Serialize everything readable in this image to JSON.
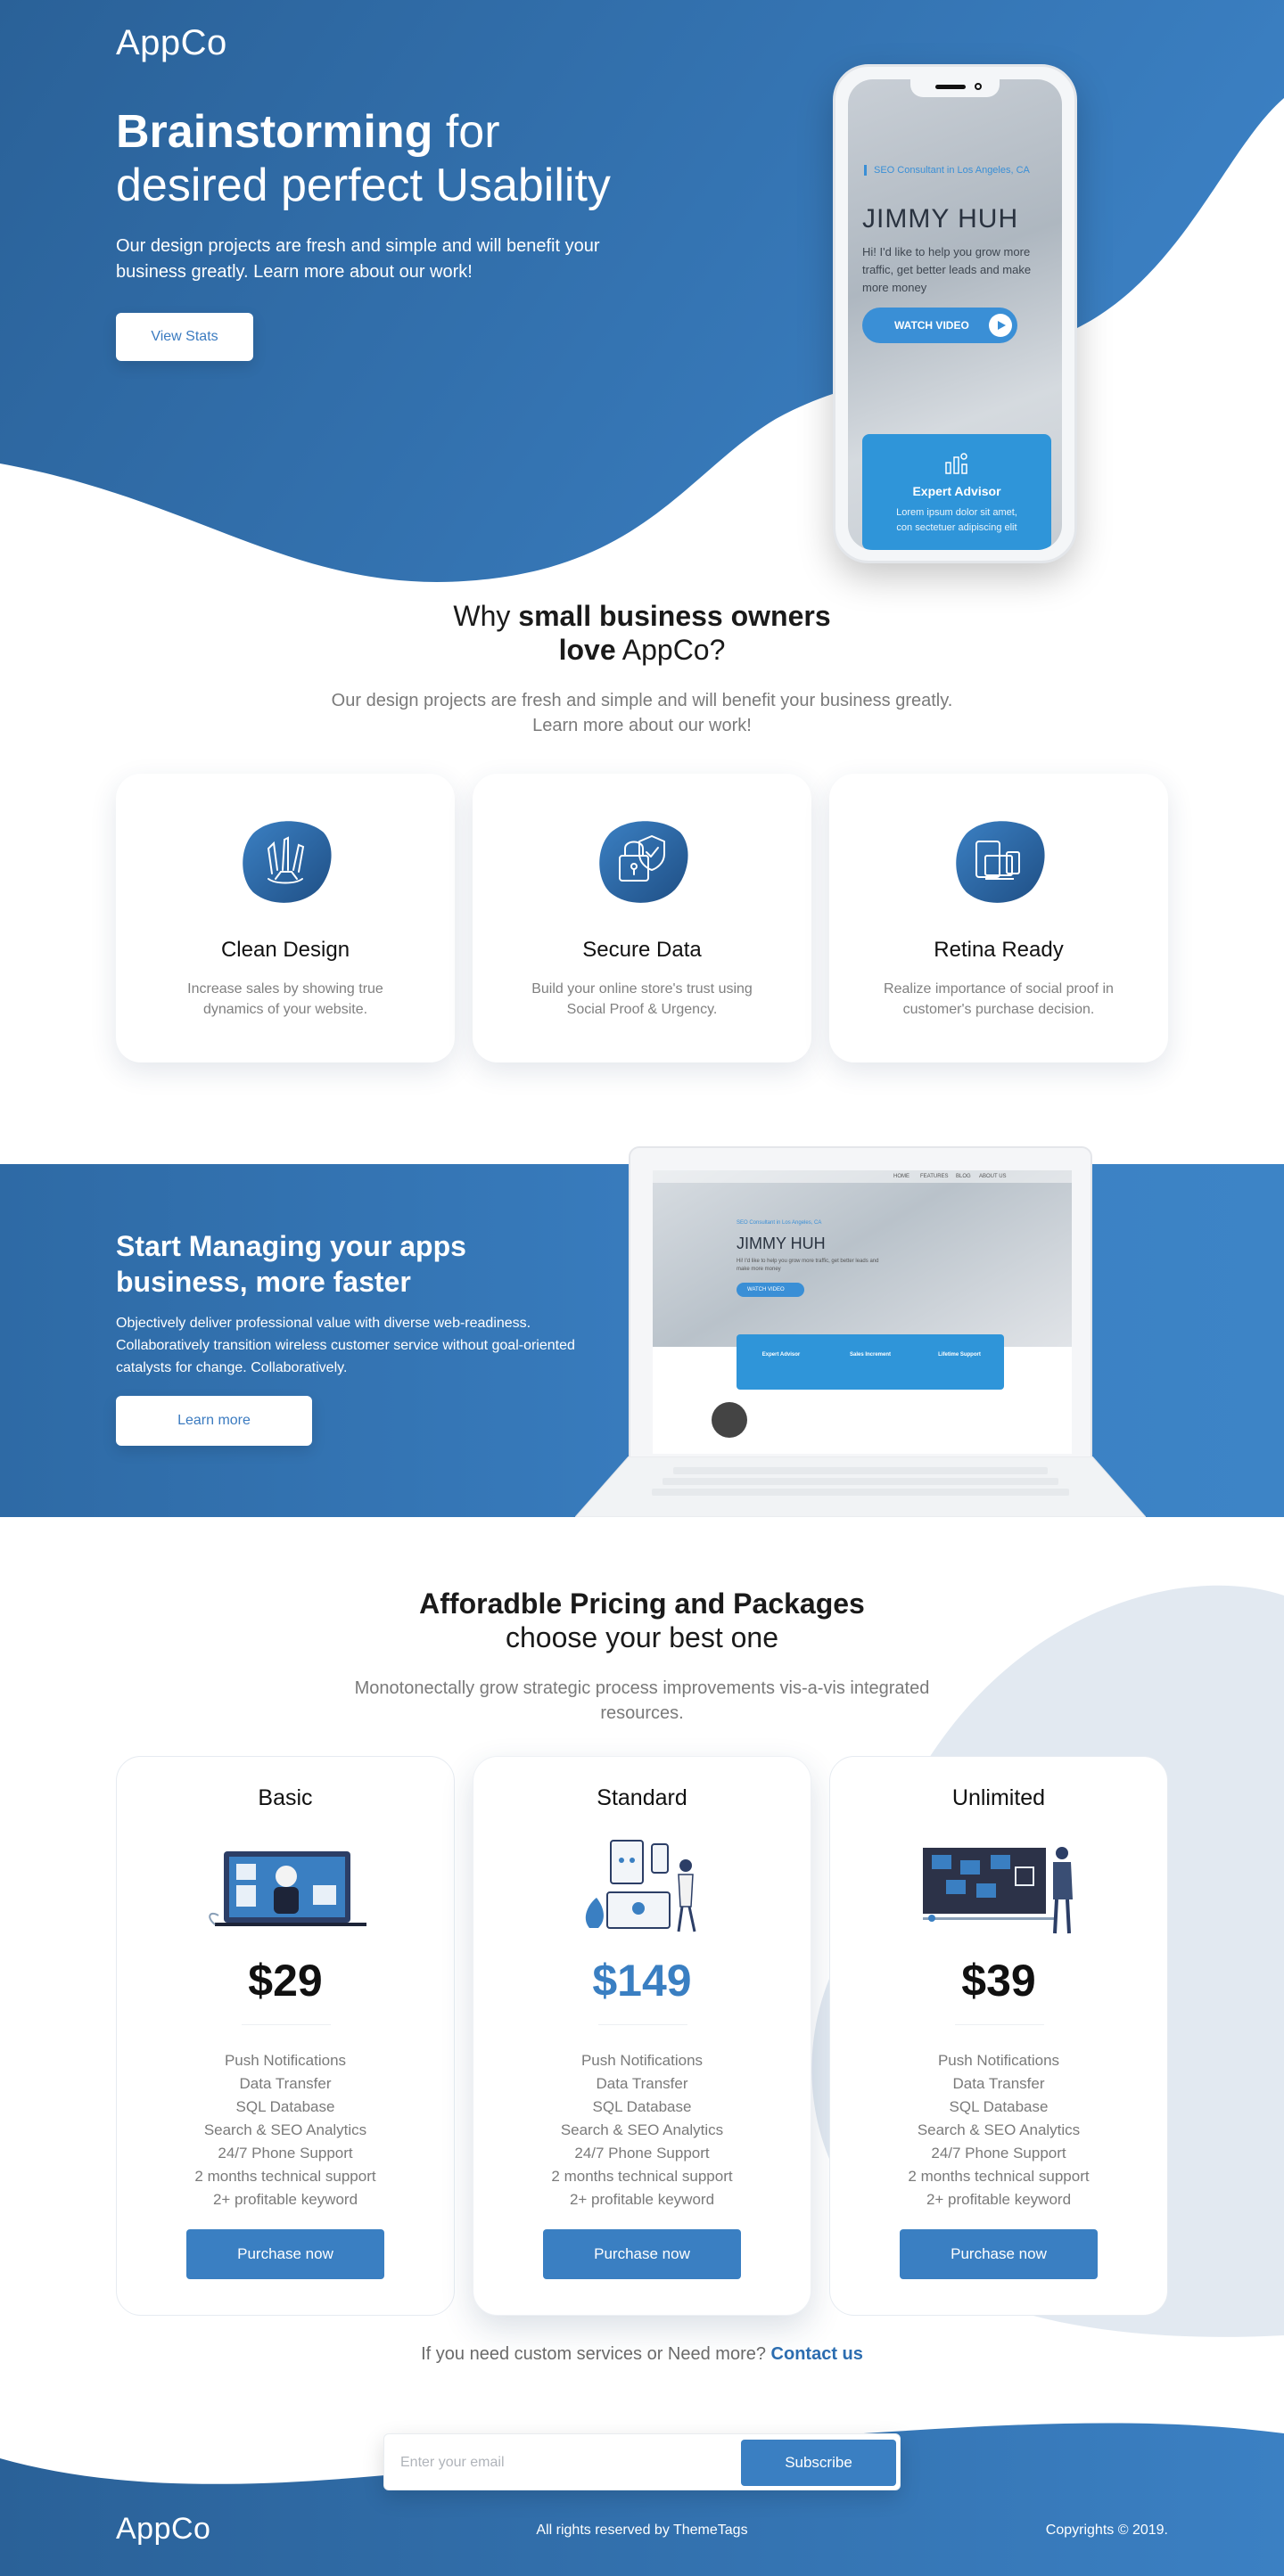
{
  "hero": {
    "logo": "AppCo",
    "title_bold": "Brainstorming",
    "title_rest": " for",
    "title_line2": "desired perfect Usability",
    "description": "Our design projects are fresh and simple and will benefit your business greatly. Learn more about our work!",
    "button": "View Stats",
    "phone": {
      "tag": "SEO Consultant in Los Angeles, CA",
      "name": "JIMMY HUH",
      "text": "Hi! I'd like to help you grow more traffic, get better leads and make more money",
      "button": "WATCH VIDEO",
      "card_title": "Expert Advisor",
      "card_text": "Lorem ipsum dolor sit amet, con sectetuer adipiscing elit"
    }
  },
  "why": {
    "title_part1": "Why ",
    "title_bold": "small business owners",
    "title_bold2": "love",
    "title_part2": " AppCo?",
    "description": "Our design projects are fresh and simple and will benefit your business greatly. Learn more about our work!",
    "features": [
      {
        "title": "Clean Design",
        "text": "Increase sales by showing true dynamics of your website.",
        "icon": "pencils-icon"
      },
      {
        "title": "Secure Data",
        "text": "Build your online store's trust using Social Proof & Urgency.",
        "icon": "lock-shield-icon"
      },
      {
        "title": "Retina Ready",
        "text": "Realize importance of social proof in customer's purchase decision.",
        "icon": "devices-icon"
      }
    ]
  },
  "manage": {
    "title": "Start Managing your apps business, more faster",
    "description": "Objectively deliver professional value with diverse web-readiness. Collaboratively transition wireless customer service without goal-oriented catalysts for change. Collaboratively.",
    "button": "Learn more",
    "laptop": {
      "nav": [
        "HOME",
        "FEATURES",
        "BLOG",
        "ABOUT US"
      ],
      "tag": "SEO Consultant in Los Angeles, CA",
      "name": "JIMMY HUH",
      "text": "Hi! I'd like to help you grow more traffic, get better leads and make more money",
      "button": "WATCH VIDEO",
      "cards": [
        "Expert Advisor",
        "Sales Increment",
        "Lifetime Support"
      ]
    }
  },
  "pricing": {
    "title_bold": "Afforadble Pricing and Packages",
    "title_line2": "choose your best one",
    "description": "Monotonectally grow strategic process improvements vis-a-vis integrated resources.",
    "plans": [
      {
        "name": "Basic",
        "price": "$29",
        "button": "Purchase now",
        "features": [
          "Push Notifications",
          "Data Transfer",
          "SQL Database",
          "Search & SEO Analytics",
          "24/7 Phone Support",
          "2 months technical support",
          "2+ profitable keyword"
        ]
      },
      {
        "name": "Standard",
        "price": "$149",
        "button": "Purchase now",
        "features": [
          "Push Notifications",
          "Data Transfer",
          "SQL Database",
          "Search & SEO Analytics",
          "24/7 Phone Support",
          "2 months technical support",
          "2+ profitable keyword"
        ]
      },
      {
        "name": "Unlimited",
        "price": "$39",
        "button": "Purchase now",
        "features": [
          "Push Notifications",
          "Data Transfer",
          "SQL Database",
          "Search & SEO Analytics",
          "24/7 Phone Support",
          "2 months technical support",
          "2+ profitable keyword"
        ]
      }
    ],
    "contact_text": "If you need custom services or Need more? ",
    "contact_link": "Contact us"
  },
  "footer": {
    "email_placeholder": "Enter your email",
    "subscribe": "Subscribe",
    "logo": "AppCo",
    "rights": "All rights reserved by ThemeTags",
    "copyright": "Copyrights © 2019."
  },
  "colors": {
    "primary": "#3a7fc2",
    "primary_dark": "#2a6198",
    "light_blob": "#e2e9f1"
  }
}
